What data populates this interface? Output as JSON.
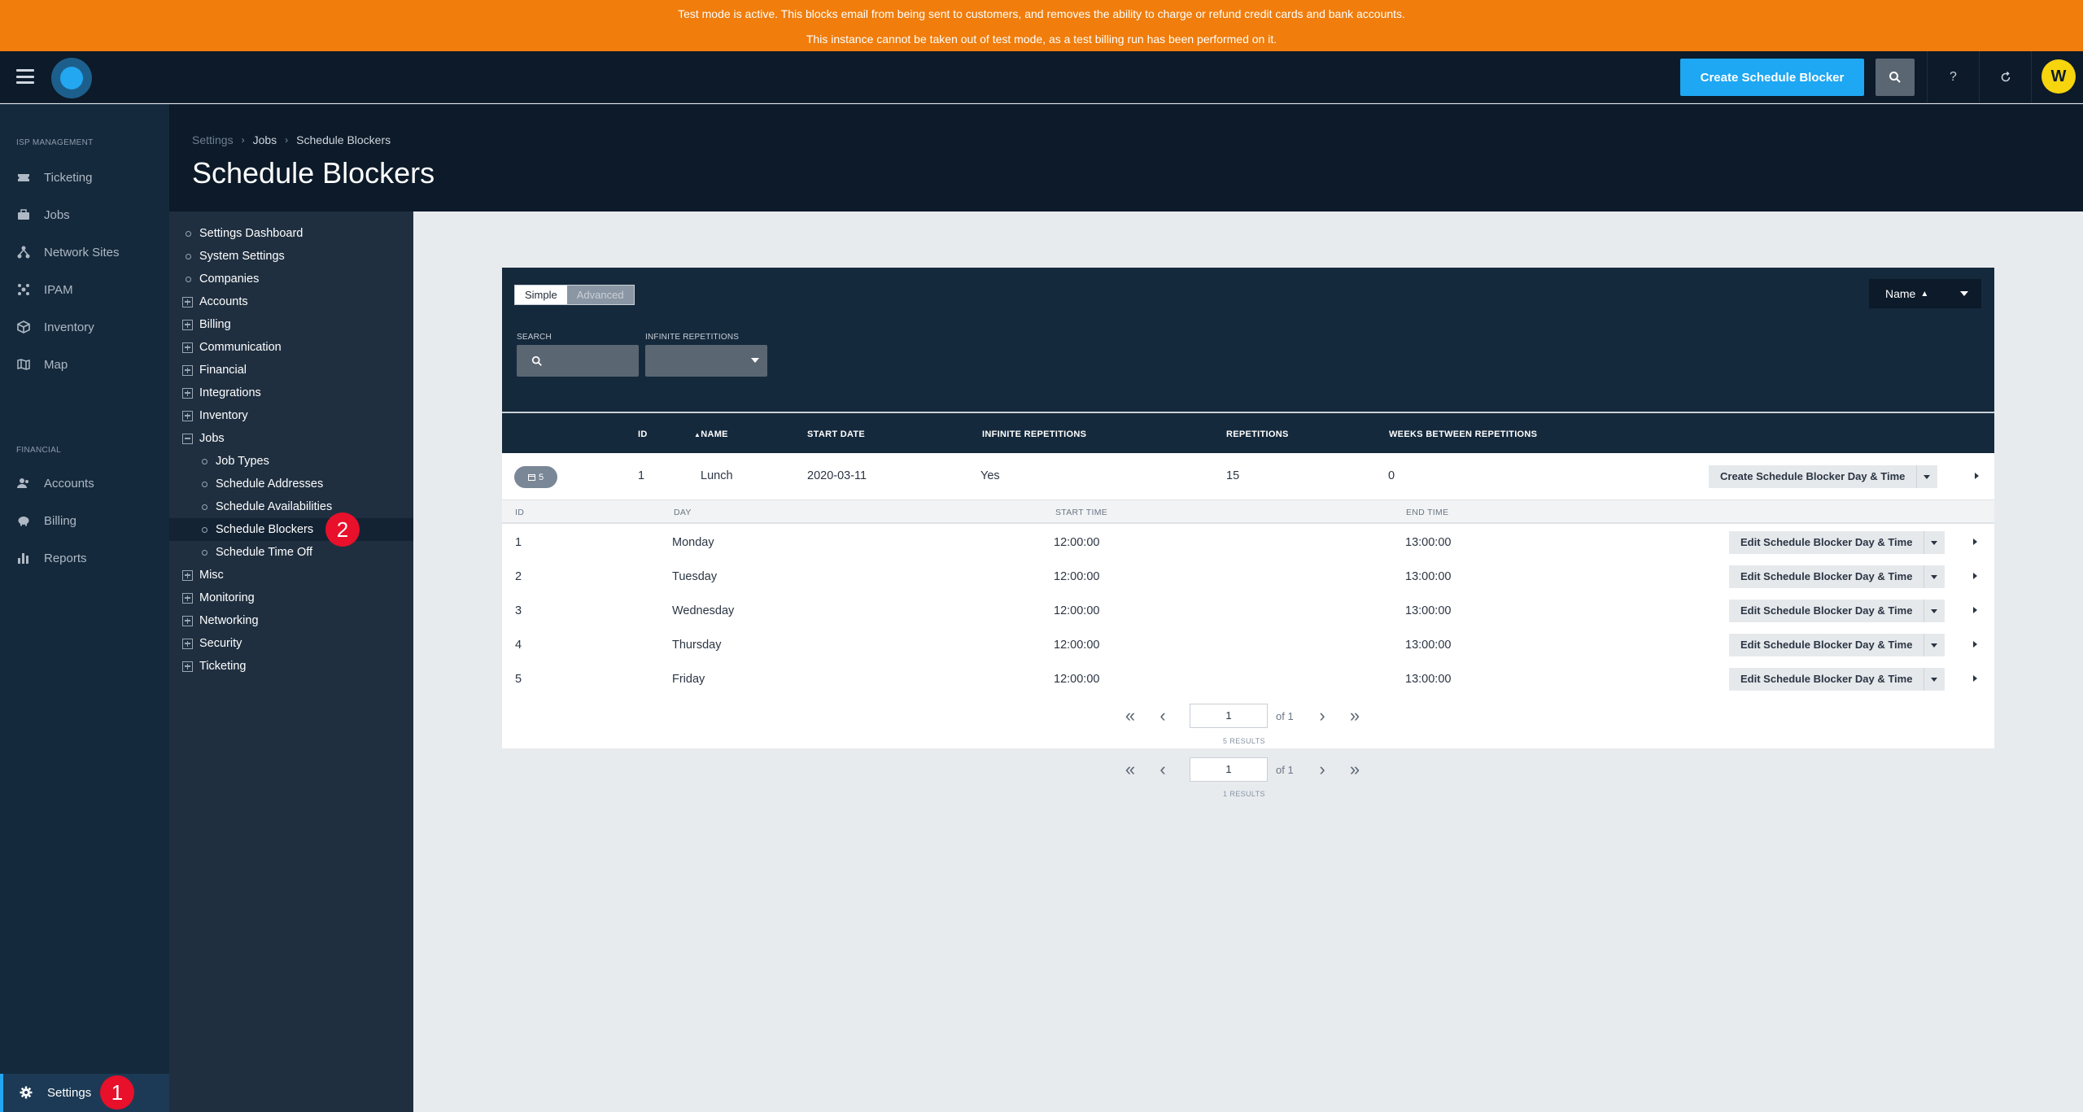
{
  "banner": {
    "line1": "Test mode is active. This blocks email from being sent to customers, and removes the ability to charge or refund credit cards and bank accounts.",
    "line2": "This instance cannot be taken out of test mode, as a test billing run has been performed on it."
  },
  "topbar": {
    "create_button": "Create Schedule Blocker",
    "help": "?",
    "avatar_initial": "W"
  },
  "leftnav": {
    "sections": [
      {
        "title": "ISP MANAGEMENT",
        "items": [
          {
            "label": "Ticketing",
            "icon": "ticket-icon"
          },
          {
            "label": "Jobs",
            "icon": "briefcase-icon"
          },
          {
            "label": "Network Sites",
            "icon": "network-icon"
          },
          {
            "label": "IPAM",
            "icon": "ipam-icon"
          },
          {
            "label": "Inventory",
            "icon": "box-icon"
          },
          {
            "label": "Map",
            "icon": "map-icon"
          }
        ]
      },
      {
        "title": "FINANCIAL",
        "items": [
          {
            "label": "Accounts",
            "icon": "users-icon"
          },
          {
            "label": "Billing",
            "icon": "piggy-bank-icon"
          },
          {
            "label": "Reports",
            "icon": "bar-chart-icon"
          }
        ]
      }
    ],
    "settings": "Settings",
    "badge1": "1"
  },
  "breadcrumb": [
    "Settings",
    "Jobs",
    "Schedule Blockers"
  ],
  "page_title": "Schedule Blockers",
  "tree": {
    "items": [
      {
        "label": "Settings Dashboard",
        "type": "dot",
        "level": 0
      },
      {
        "label": "System Settings",
        "type": "dot",
        "level": 0
      },
      {
        "label": "Companies",
        "type": "dot",
        "level": 0
      },
      {
        "label": "Accounts",
        "type": "plus",
        "level": 0
      },
      {
        "label": "Billing",
        "type": "plus",
        "level": 0
      },
      {
        "label": "Communication",
        "type": "plus",
        "level": 0
      },
      {
        "label": "Financial",
        "type": "plus",
        "level": 0
      },
      {
        "label": "Integrations",
        "type": "plus",
        "level": 0
      },
      {
        "label": "Inventory",
        "type": "plus",
        "level": 0
      },
      {
        "label": "Jobs",
        "type": "minus",
        "level": 0
      },
      {
        "label": "Job Types",
        "type": "dot",
        "level": 1
      },
      {
        "label": "Schedule Addresses",
        "type": "dot",
        "level": 1
      },
      {
        "label": "Schedule Availabilities",
        "type": "dot",
        "level": 1
      },
      {
        "label": "Schedule Blockers",
        "type": "dot",
        "level": 1,
        "active": true
      },
      {
        "label": "Schedule Time Off",
        "type": "dot",
        "level": 1
      },
      {
        "label": "Misc",
        "type": "plus",
        "level": 0
      },
      {
        "label": "Monitoring",
        "type": "plus",
        "level": 0
      },
      {
        "label": "Networking",
        "type": "plus",
        "level": 0
      },
      {
        "label": "Security",
        "type": "plus",
        "level": 0
      },
      {
        "label": "Ticketing",
        "type": "plus",
        "level": 0
      }
    ],
    "badge2": "2"
  },
  "filters": {
    "simple": "Simple",
    "advanced": "Advanced",
    "search_label": "SEARCH",
    "infinite_label": "INFINITE REPETITIONS",
    "sort": "Name"
  },
  "table": {
    "headers": [
      "ID",
      "NAME",
      "START DATE",
      "INFINITE REPETITIONS",
      "REPETITIONS",
      "WEEKS BETWEEN REPETITIONS"
    ],
    "row": {
      "count": "5",
      "id": "1",
      "name": "Lunch",
      "start_date": "2020-03-11",
      "infinite": "Yes",
      "repetitions": "15",
      "weeks_between": "0",
      "action": "Create Schedule Blocker Day & Time"
    },
    "sub_headers": [
      "ID",
      "DAY",
      "START TIME",
      "END TIME"
    ],
    "sub_rows": [
      {
        "id": "1",
        "day": "Monday",
        "start": "12:00:00",
        "end": "13:00:00",
        "action": "Edit Schedule Blocker Day & Time"
      },
      {
        "id": "2",
        "day": "Tuesday",
        "start": "12:00:00",
        "end": "13:00:00",
        "action": "Edit Schedule Blocker Day & Time"
      },
      {
        "id": "3",
        "day": "Wednesday",
        "start": "12:00:00",
        "end": "13:00:00",
        "action": "Edit Schedule Blocker Day & Time"
      },
      {
        "id": "4",
        "day": "Thursday",
        "start": "12:00:00",
        "end": "13:00:00",
        "action": "Edit Schedule Blocker Day & Time"
      },
      {
        "id": "5",
        "day": "Friday",
        "start": "12:00:00",
        "end": "13:00:00",
        "action": "Edit Schedule Blocker Day & Time"
      }
    ]
  },
  "pagination_inner": {
    "page": "1",
    "of": "of 1",
    "results": "5 RESULTS"
  },
  "pagination_outer": {
    "page": "1",
    "of": "of 1",
    "results": "1 RESULTS"
  }
}
